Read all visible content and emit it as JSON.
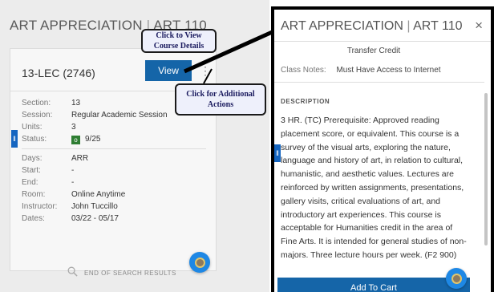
{
  "left": {
    "course_name": "ART APPRECIATION",
    "separator": "|",
    "course_code": "ART 110",
    "section_title": "13-LEC (2746)",
    "view_label": "View",
    "kebab": "⋮",
    "details_a": [
      {
        "label": "Section:",
        "value": "13"
      },
      {
        "label": "Session:",
        "value": "Regular Academic Session"
      },
      {
        "label": "Units:",
        "value": "3"
      }
    ],
    "status": {
      "label": "Status:",
      "badge": "o",
      "value": "9/25",
      "color": "#2e7d32"
    },
    "details_b": [
      {
        "label": "Days:",
        "value": "ARR"
      },
      {
        "label": "Start:",
        "value": "-"
      },
      {
        "label": "End:",
        "value": "-"
      },
      {
        "label": "Room:",
        "value": "Online Anytime"
      },
      {
        "label": "Instructor:",
        "value": "John Tuccillo"
      },
      {
        "label": "Dates:",
        "value": "03/22 - 05/17"
      }
    ],
    "end_of_results": "END OF SEARCH RESULTS"
  },
  "callouts": {
    "view_details": "Click to View Course Details",
    "additional_actions": "Click for Additional Actions"
  },
  "right": {
    "course_name": "ART APPRECIATION",
    "separator": "|",
    "course_code": "ART 110",
    "close": "×",
    "transfer": "Transfer Credit",
    "notes_label": "Class Notes:",
    "notes_value": "Must Have Access to Internet",
    "desc_heading": "DESCRIPTION",
    "description": "3 HR. (TC) Prerequisite: Approved reading placement score, or equivalent. This course is a survey of the visual arts, exploring the nature, language and history of art, in relation to cultural, humanistic, and aesthetic values. Lectures are reinforced by written assignments, presentations, gallery visits, critical evaluations of art, and introductory art experiences. This course is acceptable for Humanities credit in the area of Fine Arts. It is intended for general studies of non-majors. Three lecture hours per week. (F2 900)",
    "add_to_cart": "Add To Cart"
  },
  "icons": {
    "search": "search-icon",
    "help": "help-fab-icon",
    "collapse": "collapse-tab-icon"
  },
  "colors": {
    "primary": "#1565a8",
    "fab": "#1e88e5",
    "callout_bg": "#eef0fb"
  }
}
